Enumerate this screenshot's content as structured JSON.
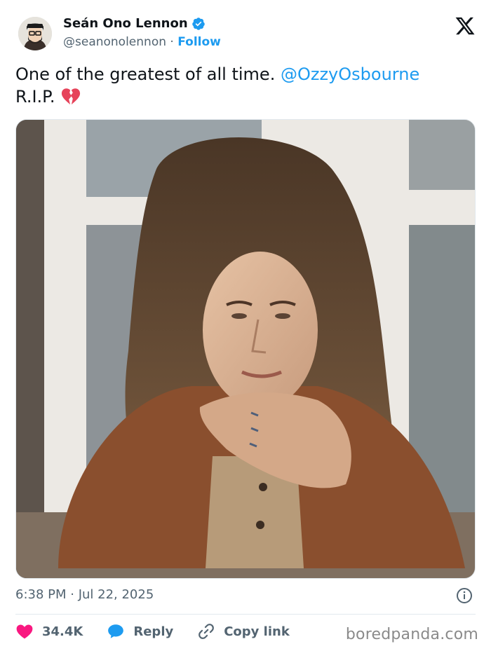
{
  "author": {
    "display_name": "Seán Ono Lennon",
    "handle": "@seanonolennon",
    "separator": "·",
    "follow_label": "Follow"
  },
  "tweet": {
    "text": "One of the greatest of all time.",
    "mention": "@OzzyOsbourne",
    "text_line2": "R.I.P.",
    "emoji": "broken-heart-icon",
    "timestamp": "6:38 PM · Jul 22, 2025"
  },
  "actions": {
    "likes_count": "34.4K",
    "reply_label": "Reply",
    "copy_link_label": "Copy link"
  },
  "watermark": "boredpanda.com",
  "colors": {
    "accent": "#1d9bf0",
    "like": "#f91880",
    "text": "#0f1419",
    "muted": "#536471"
  }
}
